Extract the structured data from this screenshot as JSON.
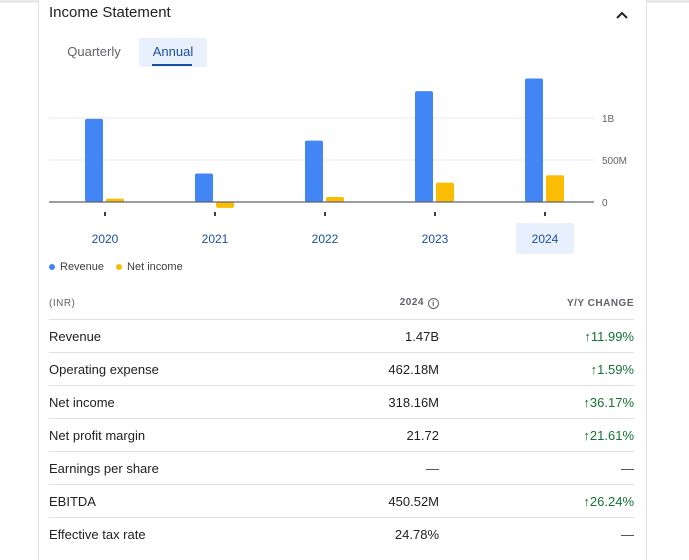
{
  "header": {
    "title": "Income Statement"
  },
  "tabs": {
    "quarterly": "Quarterly",
    "annual": "Annual"
  },
  "chart_data": {
    "type": "bar",
    "categories": [
      "2020",
      "2021",
      "2022",
      "2023",
      "2024"
    ],
    "series": [
      {
        "name": "Revenue",
        "values": [
          0.99,
          0.34,
          0.73,
          1.32,
          1.47
        ],
        "color": "#4285f4"
      },
      {
        "name": "Net income",
        "values": [
          0.04,
          -0.07,
          0.06,
          0.23,
          0.318
        ],
        "color": "#fbbc04"
      }
    ],
    "y_ticks": [
      {
        "v": 0,
        "label": "0"
      },
      {
        "v": 0.5,
        "label": "500M"
      },
      {
        "v": 1.0,
        "label": "1B"
      }
    ],
    "ylim": [
      -0.1,
      1.5
    ],
    "selected_category": "2024",
    "legend_position": "bottom-left"
  },
  "legend": {
    "revenue": "Revenue",
    "net_income": "Net income"
  },
  "table": {
    "header": {
      "currency": "(INR)",
      "year": "2024",
      "change": "Y/Y CHANGE"
    },
    "rows": [
      {
        "label": "Revenue",
        "value": "1.47B",
        "change": "11.99%",
        "up": true
      },
      {
        "label": "Operating expense",
        "value": "462.18M",
        "change": "1.59%",
        "up": true
      },
      {
        "label": "Net income",
        "value": "318.16M",
        "change": "36.17%",
        "up": true
      },
      {
        "label": "Net profit margin",
        "value": "21.72",
        "change": "21.61%",
        "up": true
      },
      {
        "label": "Earnings per share",
        "value": "—",
        "change": "—",
        "up": false
      },
      {
        "label": "EBITDA",
        "value": "450.52M",
        "change": "26.24%",
        "up": true
      },
      {
        "label": "Effective tax rate",
        "value": "24.78%",
        "change": "—",
        "up": false
      }
    ]
  },
  "colors": {
    "up": "#137333",
    "accent": "#1a4fa0",
    "selected_bg": "#e8f0fe"
  }
}
